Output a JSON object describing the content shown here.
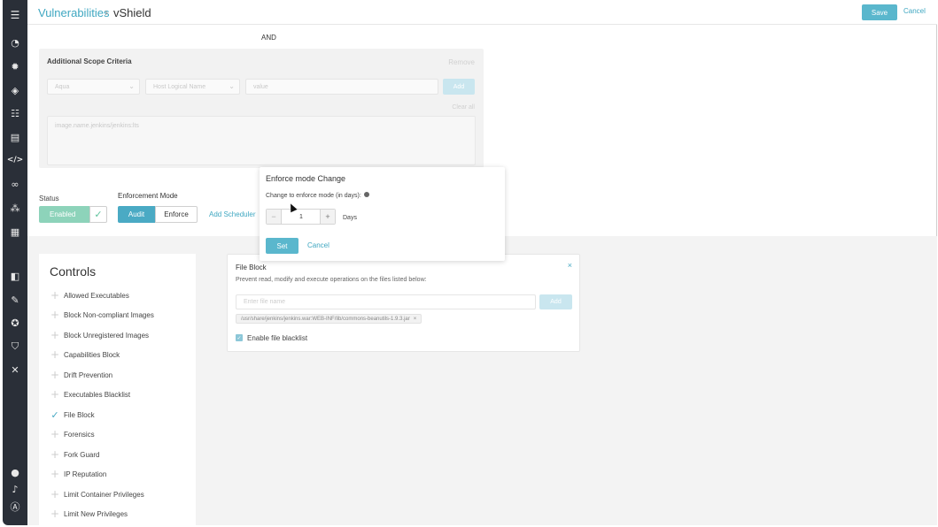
{
  "header": {
    "breadcrumb_parent": "Vulnerabilities",
    "breadcrumb_separator": "›",
    "breadcrumb_current": "vShield",
    "save_label": "Save",
    "cancel_label": "Cancel"
  },
  "sidebar": {
    "icons": [
      "menu-icon",
      "dashboard-icon",
      "bug-icon",
      "layers-icon",
      "policies-icon",
      "storage-icon",
      "code-icon",
      "link-icon",
      "nodes-icon",
      "calendar-icon",
      "tag-icon",
      "wrench-icon",
      "badge-icon",
      "shield-icon",
      "tools-icon",
      "help-icon",
      "bell-icon",
      "user-icon"
    ]
  },
  "scope": {
    "and_label": "AND",
    "title": "Additional Scope Criteria",
    "remove_label": "Remove",
    "select1": "Aqua",
    "select2": "Host Logical Name",
    "value_placeholder": "value",
    "add_label": "Add",
    "clear_all_label": "Clear all",
    "textarea_placeholder": "image.name.jenkins/jenkins:lts"
  },
  "status": {
    "label": "Status",
    "value": "Enabled"
  },
  "enforcement": {
    "label": "Enforcement Mode",
    "modes": [
      "Audit",
      "Enforce"
    ],
    "selected": "Audit",
    "add_scheduler_label": "Add Scheduler"
  },
  "popup": {
    "title": "Enforce mode Change",
    "subtitle": "Change to enforce mode (in days):",
    "minus": "−",
    "value": "1",
    "plus": "+",
    "days_label": "Days",
    "set_label": "Set",
    "cancel_label": "Cancel"
  },
  "controls": {
    "title": "Controls",
    "items": [
      {
        "label": "Allowed Executables",
        "checked": false
      },
      {
        "label": "Block Non-compliant Images",
        "checked": false
      },
      {
        "label": "Block Unregistered Images",
        "checked": false
      },
      {
        "label": "Capabilities Block",
        "checked": false
      },
      {
        "label": "Drift Prevention",
        "checked": false
      },
      {
        "label": "Executables Blacklist",
        "checked": false
      },
      {
        "label": "File Block",
        "checked": true
      },
      {
        "label": "Forensics",
        "checked": false
      },
      {
        "label": "Fork Guard",
        "checked": false
      },
      {
        "label": "IP Reputation",
        "checked": false
      },
      {
        "label": "Limit Container Privileges",
        "checked": false
      },
      {
        "label": "Limit New Privileges",
        "checked": false
      }
    ]
  },
  "file_block": {
    "title": "File Block",
    "close": "×",
    "description": "Prevent read, modify and execute operations on the files listed below:",
    "input_placeholder": "Enter file name",
    "add_label": "Add",
    "tag": "/usr/share/jenkins/jenkins.war:WEB-INF/lib/commons-beanutils-1.9.3.jar",
    "tag_remove": "×",
    "checkbox_label": "Enable file blacklist",
    "checkbox_checked": true
  }
}
